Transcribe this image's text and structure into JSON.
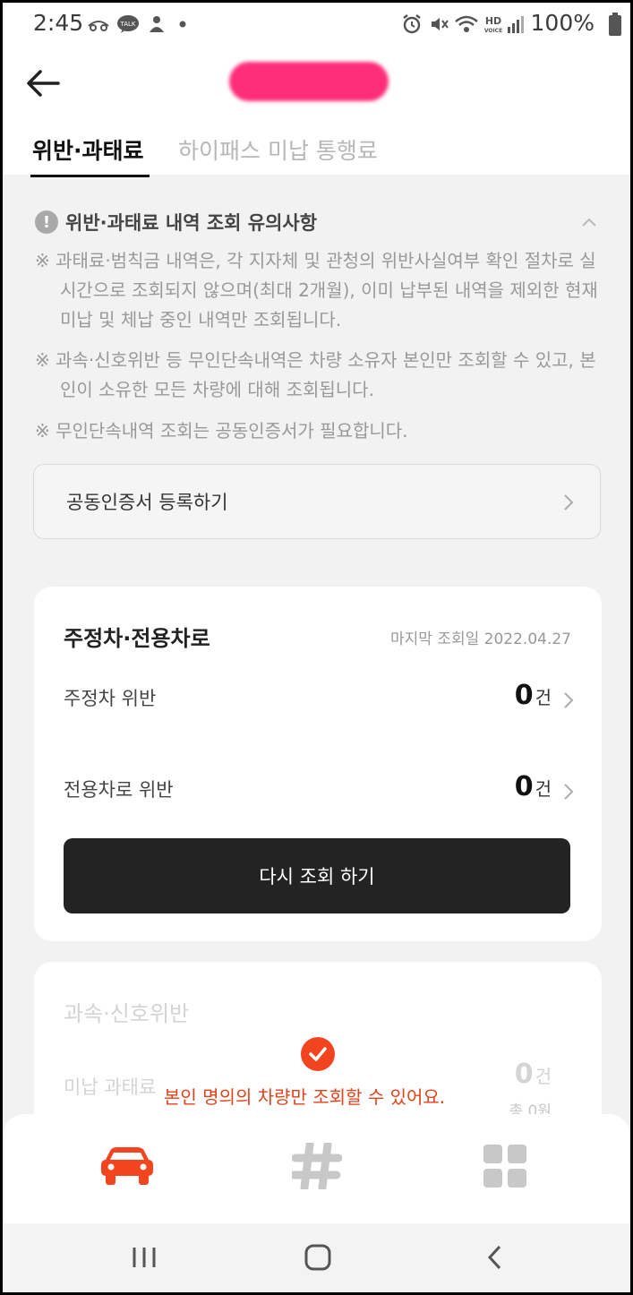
{
  "status_bar": {
    "time": "2:45",
    "battery": "100%",
    "icons": [
      "car-link-icon",
      "kakaotalk-icon",
      "app-icon",
      "dot-icon",
      "alarm-icon",
      "mute-icon",
      "wifi-icon",
      "hd-voice-icon",
      "signal-icon",
      "battery-icon"
    ]
  },
  "header": {
    "back_icon": "arrow-left-icon",
    "tabs": [
      {
        "label": "위반·과태료",
        "active": true
      },
      {
        "label": "하이패스 미납 통행료",
        "active": false
      }
    ]
  },
  "notice": {
    "title": "위반·과태료 내역 조회 유의사항",
    "items": [
      "※ 과태료·범칙금 내역은, 각 지자체 및 관청의 위반사실여부 확인 절차로 실시간으로 조회되지 않으며(최대 2개월), 이미 납부된 내역을 제외한 현재 미납 및 체납 중인 내역만 조회됩니다.",
      "※ 과속·신호위반 등 무인단속내역은 차량 소유자 본인만 조회할 수 있고, 본인이 소유한 모든 차량에 대해 조회됩니다.",
      "※ 무인단속내역 조회는 공동인증서가 필요합니다."
    ],
    "cert_button": "공동인증서 등록하기"
  },
  "parking_card": {
    "title": "주정차·전용차로",
    "last_query": "마지막 조회일 2022.04.27",
    "rows": [
      {
        "label": "주정차 위반",
        "count": "0",
        "unit": "건"
      },
      {
        "label": "전용차로 위반",
        "count": "0",
        "unit": "건"
      }
    ],
    "requery_button": "다시 조회 하기"
  },
  "speed_card": {
    "title": "과속·신호위반",
    "row_label": "미납 과태료",
    "count": "0",
    "unit": "건",
    "total": "총 0원"
  },
  "toast": {
    "text": "본인 명의의 차량만 조회할 수 있어요.",
    "color": "#e0421a"
  },
  "bottom_nav": [
    "car-icon",
    "hashtag-icon",
    "grid-icon"
  ],
  "system_nav": [
    "recents-icon",
    "home-icon",
    "back-chevron-icon"
  ],
  "colors": {
    "accent": "#f2451f",
    "button_dark": "#232323",
    "tab_inactive": "#b7b7b7"
  }
}
